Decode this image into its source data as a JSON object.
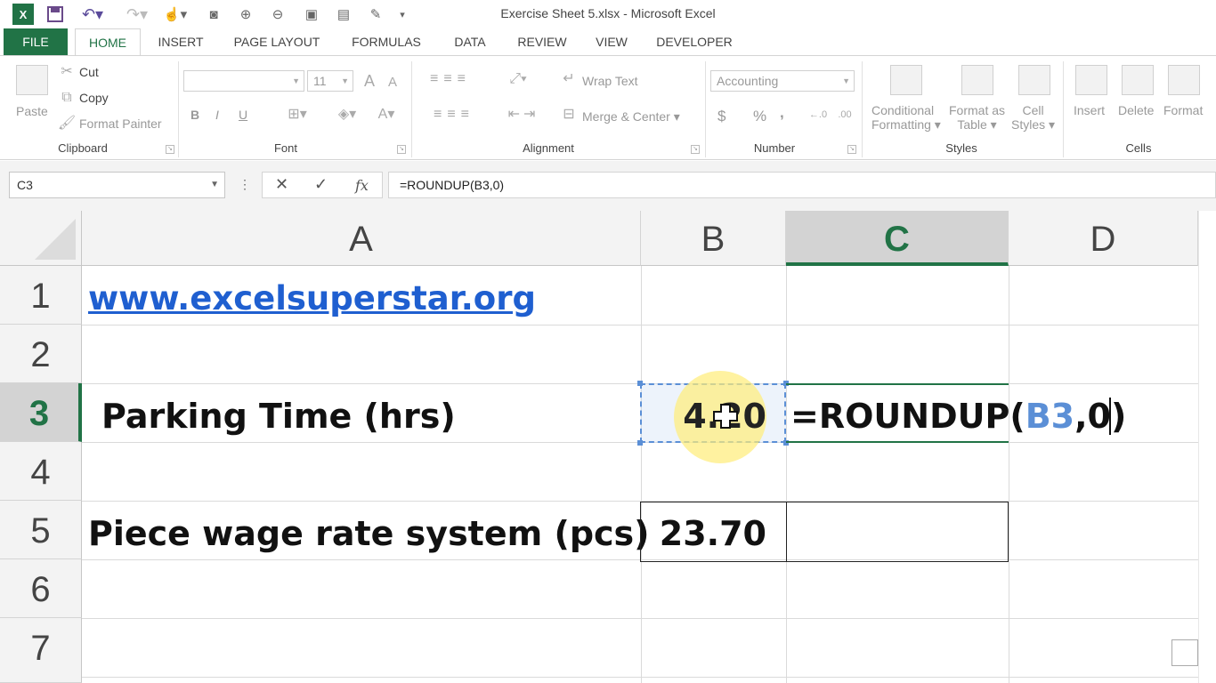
{
  "window": {
    "title": "Exercise Sheet 5.xlsx - Microsoft Excel"
  },
  "tabs": [
    "FILE",
    "HOME",
    "INSERT",
    "PAGE LAYOUT",
    "FORMULAS",
    "DATA",
    "REVIEW",
    "VIEW",
    "DEVELOPER"
  ],
  "ribbon": {
    "clipboard": {
      "label": "Clipboard",
      "paste": "Paste",
      "cut": "Cut",
      "copy": "Copy",
      "format_painter": "Format Painter"
    },
    "font": {
      "label": "Font",
      "font_size": "11",
      "bold": "B",
      "italic": "I",
      "underline": "U"
    },
    "alignment": {
      "label": "Alignment",
      "wrap_text": "Wrap Text",
      "merge_center": "Merge & Center"
    },
    "number": {
      "label": "Number",
      "format": "Accounting",
      "currency": "$",
      "percent": "%",
      "comma": ","
    },
    "styles": {
      "label": "Styles",
      "conditional_1": "Conditional",
      "conditional_2": "Formatting",
      "format_table_1": "Format as",
      "format_table_2": "Table",
      "cell_styles_1": "Cell",
      "cell_styles_2": "Styles"
    },
    "cells": {
      "label": "Cells",
      "insert": "Insert",
      "delete": "Delete",
      "format": "Format"
    }
  },
  "formula_bar": {
    "name_box": "C3",
    "formula": "=ROUNDUP(B3,0)",
    "fx": "fx"
  },
  "grid": {
    "columns": [
      "A",
      "B",
      "C",
      "D"
    ],
    "rows": [
      "1",
      "2",
      "3",
      "4",
      "5",
      "6",
      "7"
    ],
    "a1": "www.excelsuperstar.org",
    "a3": "Parking Time (hrs)",
    "b3": "4.20",
    "c3_prefix": "=ROUNDUP(",
    "c3_ref": "B3",
    "c3_suffix": ",0)",
    "a5": "Piece wage rate system (pcs)",
    "b5": "23.70"
  },
  "colors": {
    "accent": "#217346",
    "link": "#1f5fd0",
    "ref": "#5b8fd6"
  }
}
